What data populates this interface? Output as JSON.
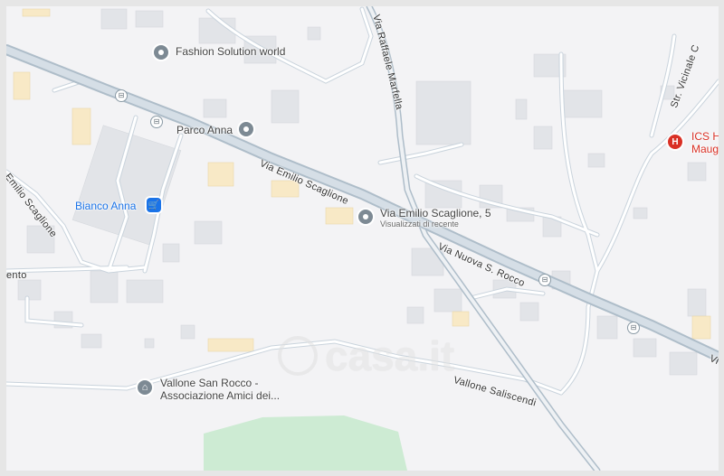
{
  "map": {
    "roads": {
      "via_emilio_scaglione": "Via Emilio Scaglione",
      "via_emilio_scaglione_west": "Emilio Scaglione",
      "via_nuova_s_rocco": "Via Nuova S. Rocco",
      "via_raffaele_marfella": "Via Raffaele Marfella",
      "vallone_saliscendi": "Vallone Saliscendi",
      "str_vicinale": "Str. Vicinale C",
      "road_west": "ento",
      "road_east_cut": "Vi"
    },
    "pois": {
      "fashion_solution": "Fashion Solution world",
      "parco_anna": "Parco Anna",
      "bianco_anna": "Bianco Anna",
      "selected_place": "Via Emilio Scaglione, 5",
      "selected_place_sub": "Visualizzati di recente",
      "vallone_line1": "Vallone San Rocco -",
      "vallone_line2": "Associazione Amici dei...",
      "hospital_line1": "ICS H",
      "hospital_line2": "Maug"
    },
    "watermark": "casa.it",
    "colors": {
      "background": "#f3f3f5",
      "road": "#ffffff",
      "road_casing": "#c9d3dc",
      "main_road": "#aebdc9",
      "building": "#e4e6ea",
      "building_highlight": "#f8e9c6",
      "park": "#cdebd3",
      "poi_blue": "#1a73e8",
      "poi_red": "#d93025"
    }
  }
}
